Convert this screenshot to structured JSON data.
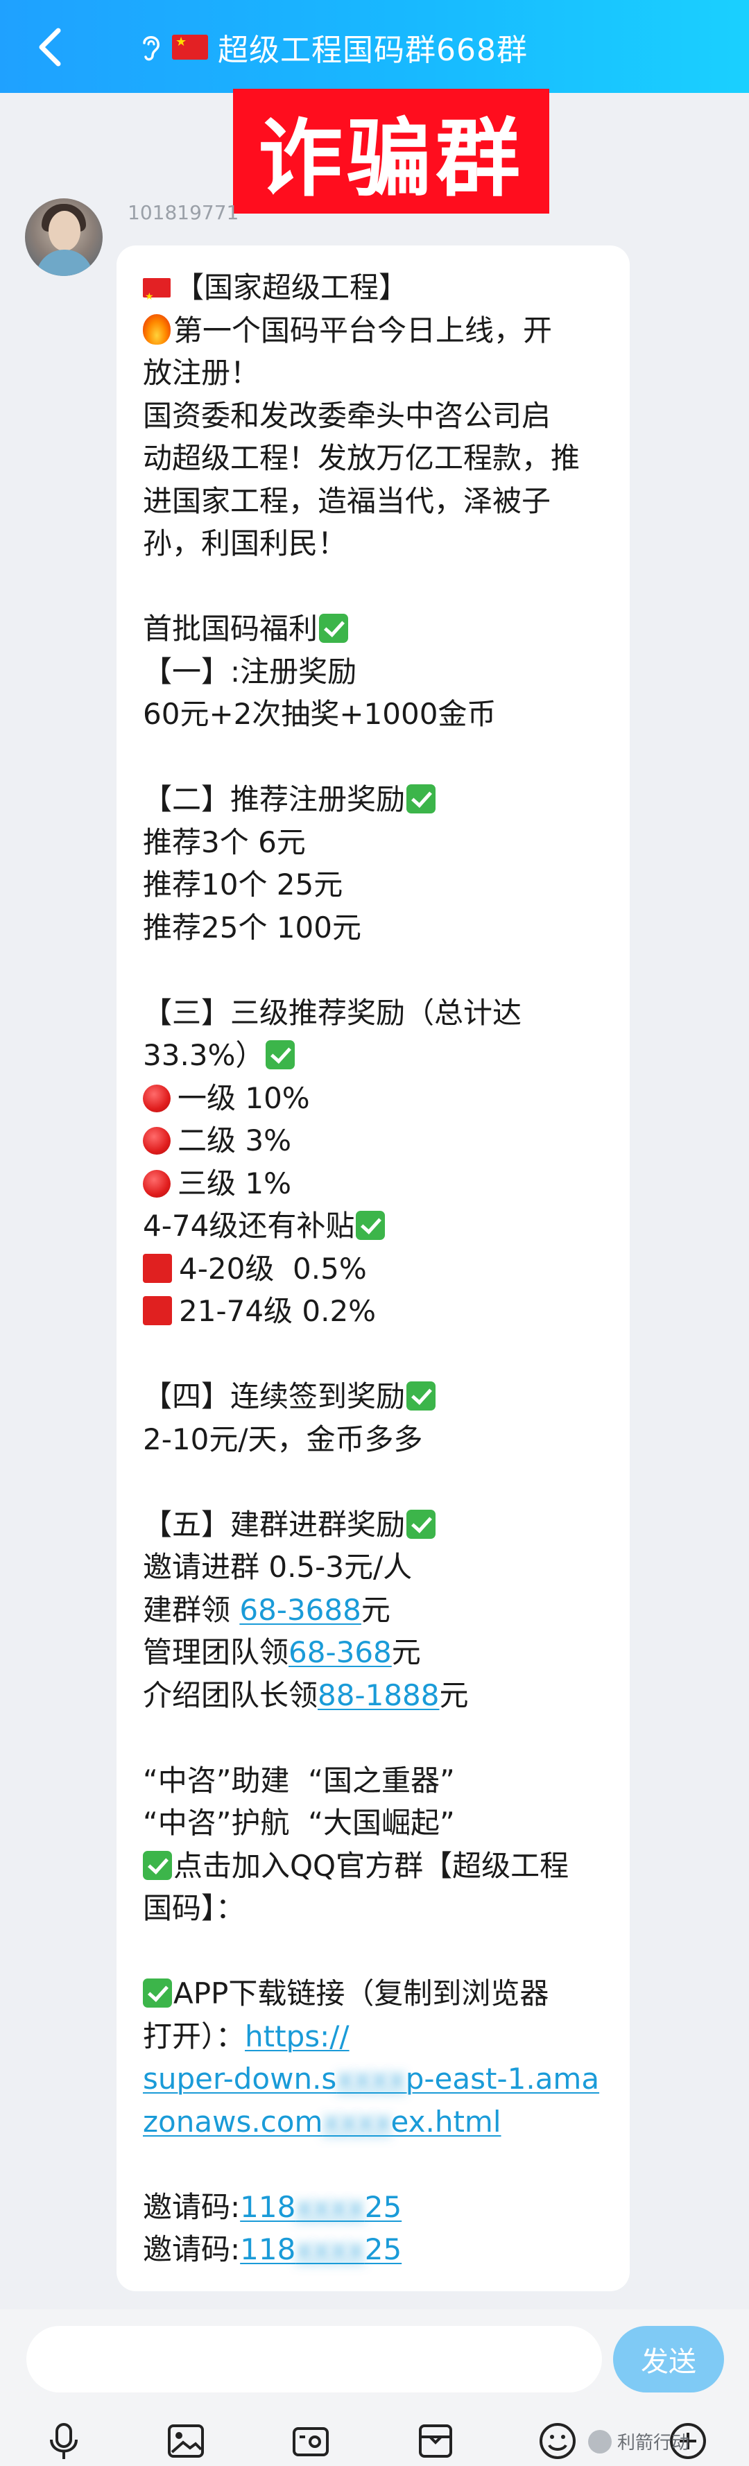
{
  "header": {
    "title": "超级工程国码群668群",
    "back_icon": "chevron-left-icon",
    "ear_icon": "ear-icon",
    "flag_icon": "china-flag-icon"
  },
  "overlay_label": "诈骗群",
  "sender": {
    "id": "101819771"
  },
  "message": {
    "lines": [
      "【国家超级工程】",
      "第一个国码平台今日上线，开",
      "放注册！",
      "国资委和发改委牵头中咨公司启",
      "动超级工程！发放万亿工程款，推",
      "进国家工程，造福当代，泽被子",
      "孙，利国利民！",
      "",
      "首批国码福利",
      "【一】:注册奖励",
      "60元+2次抽奖+1000金币",
      "",
      "【二】推荐注册奖励",
      "推荐3个 6元",
      "推荐10个 25元",
      "推荐25个 100元",
      "",
      "【三】三级推荐奖励（总计达",
      "33.3%）",
      "一级 10%",
      "二级 3%",
      "三级 1%",
      "4-74级还有补贴",
      "4-20级  0.5%",
      "21-74级 0.2%",
      "",
      "【四】连续签到奖励",
      "2-10元/天，金币多多",
      "",
      "【五】建群进群奖励",
      "邀请进群 0.5-3元/人",
      "建群领 ",
      "68-3688",
      "元",
      "管理团队领",
      "68-368",
      "元",
      "介绍团队长领",
      "88-1888",
      "元",
      "",
      "“中咨”助建  “国之重器”",
      "“中咨”护航  “大国崛起”",
      "点击加入QQ官方群【超级工程",
      "国码】：",
      "",
      "APP下载链接（复制到浏览器",
      "打开）：",
      "https://",
      "super-down.s",
      "p-east-1.ama",
      "zonaws.com",
      "ex.html",
      "",
      "邀请码:",
      "118",
      "25",
      "邀请码:",
      "118",
      "25"
    ]
  },
  "input": {
    "placeholder": "",
    "send_label": "发送"
  },
  "toolbar": {
    "icons": [
      "microphone-icon",
      "image-icon",
      "video-icon",
      "gift-icon",
      "emoji-icon",
      "plus-icon"
    ]
  },
  "watermark": "利箭行动",
  "colors": {
    "header": "#1fa1ff",
    "scam_label_bg": "#ff0d1e",
    "link": "#1a9bd8",
    "send_button": "#7fcaf5"
  }
}
